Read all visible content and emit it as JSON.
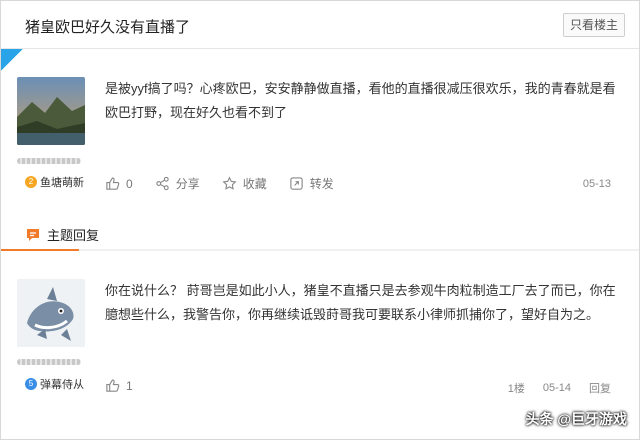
{
  "thread": {
    "title": "猪皇欧巴好久没有直播了",
    "only_op_label": "只看楼主"
  },
  "post1": {
    "username": "鱼塘萌新",
    "level": "2",
    "content": "是被yyf搞了吗？心疼欧巴，安安静静做直播，看他的直播很减压很欢乐，我的青春就是看欧巴打野，现在好久也看不到了",
    "like_count": "0",
    "share_label": "分享",
    "favorite_label": "收藏",
    "forward_label": "转发",
    "date": "05-13"
  },
  "section": {
    "title": "主题回复"
  },
  "reply1": {
    "username": "弹幕侍从",
    "level": "5",
    "content": "你在说什么？ 莳哥岂是如此小人，猪皇不直播只是去参观牛肉粒制造工厂去了而已，你在臆想些什么，我警告你，你再继续诋毁莳哥我可要联系小律师抓捕你了，望好自为之。",
    "like_count": "1",
    "floor": "1楼",
    "date": "05-14",
    "reply_label": "回复"
  },
  "watermark": "头条 @巨牙游戏",
  "colors": {
    "accent_orange": "#f07b2b",
    "level_blue": "#3a8ee6",
    "level_orange": "#f5a623"
  }
}
